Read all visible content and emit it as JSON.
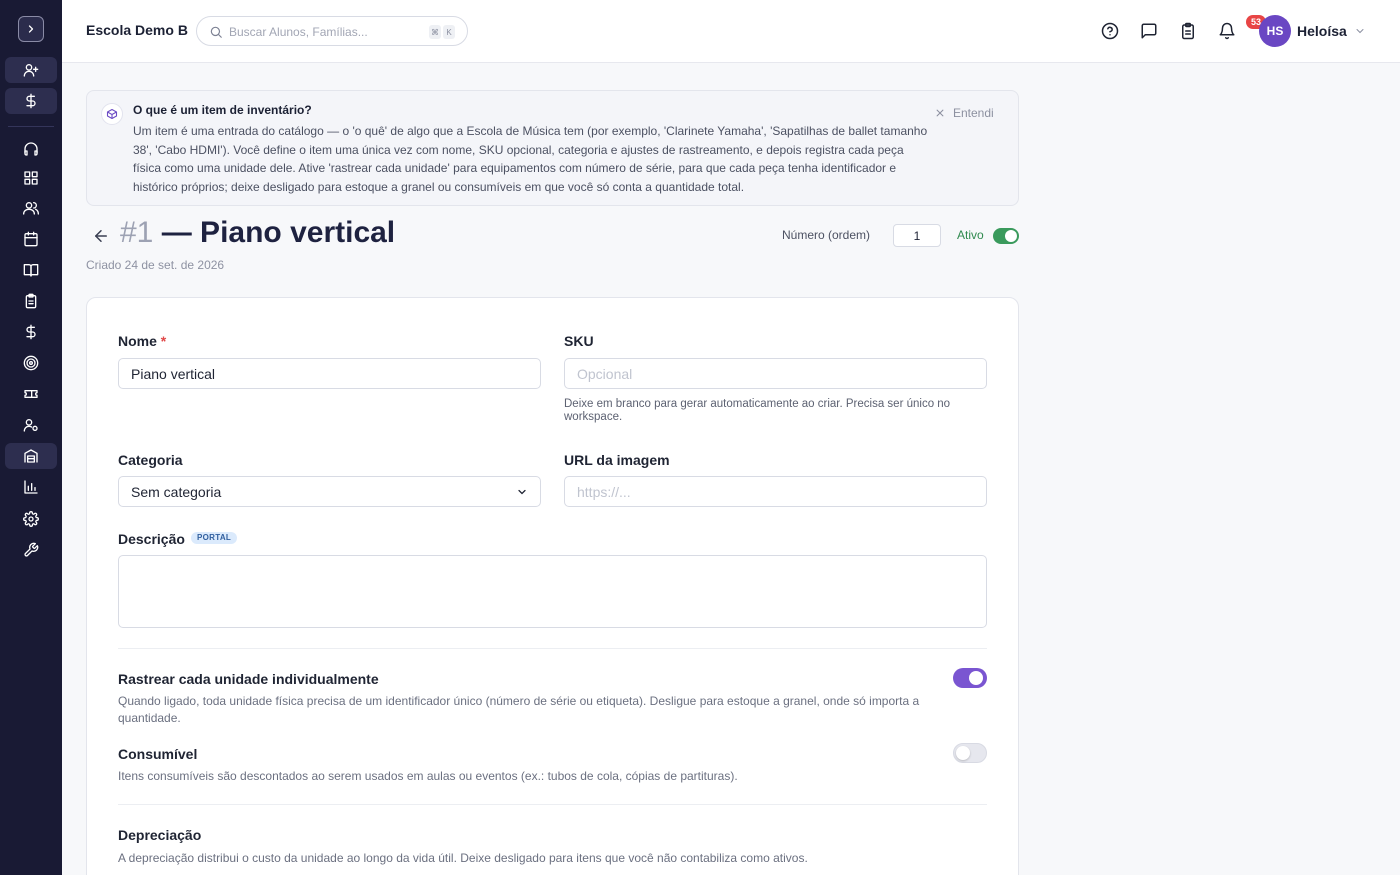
{
  "header": {
    "school_name": "Escola Demo B",
    "search_placeholder": "Buscar Alunos, Famílias...",
    "shortcut_keys": [
      "⌘",
      "K"
    ],
    "tasks_badge": "53",
    "user_initials": "HS",
    "user_name": "Heloísa"
  },
  "sidebar": {
    "items": [
      {
        "name": "add-user-icon"
      },
      {
        "name": "dollar-icon"
      },
      {
        "name": "headset-icon"
      },
      {
        "name": "dashboard-icon"
      },
      {
        "name": "users-icon"
      },
      {
        "name": "calendar-icon"
      },
      {
        "name": "book-icon"
      },
      {
        "name": "clipboard-icon"
      },
      {
        "name": "dollar-icon"
      },
      {
        "name": "target-icon"
      },
      {
        "name": "ticket-icon"
      },
      {
        "name": "user-settings-icon"
      },
      {
        "name": "inventory-icon"
      },
      {
        "name": "chart-icon"
      },
      {
        "name": "settings-icon"
      },
      {
        "name": "wrench-icon"
      }
    ]
  },
  "banner": {
    "title": "O que é um item de inventário?",
    "text": "Um item é uma entrada do catálogo — o 'o quê' de algo que a Escola de Música tem (por exemplo, 'Clarinete Yamaha', 'Sapatilhas de ballet tamanho 38', 'Cabo HDMI'). Você define o item uma única vez com nome, SKU opcional, categoria e ajustes de rastreamento, e depois registra cada peça física como uma unidade dele. Ative 'rastrear cada unidade' para equipamentos com número de série, para que cada peça tenha identificador e histórico próprios; deixe desligado para estoque a granel ou consumíveis em que você só conta a quantidade total.",
    "dismiss": "Entendi"
  },
  "title": {
    "number": "#1",
    "name": "— Piano vertical",
    "created": "Criado 24 de set. de 2026",
    "order_label": "Número (ordem)",
    "order_value": "1",
    "active_label": "Ativo",
    "active_on": true
  },
  "form": {
    "name_label": "Nome",
    "required_mark": "*",
    "name_value": "Piano vertical",
    "sku_label": "SKU",
    "sku_placeholder": "Opcional",
    "sku_help": "Deixe em branco para gerar automaticamente ao criar. Precisa ser único no workspace.",
    "category_label": "Categoria",
    "category_value": "Sem categoria",
    "image_label": "URL da imagem",
    "image_placeholder": "https://...",
    "description_label": "Descrição",
    "description_badge": "PORTAL",
    "description_value": ""
  },
  "settings": {
    "track_title": "Rastrear cada unidade individualmente",
    "track_desc": "Quando ligado, toda unidade física precisa de um identificador único (número de série ou etiqueta). Desligue para estoque a granel, onde só importa a quantidade.",
    "track_on": true,
    "consumable_title": "Consumível",
    "consumable_desc": "Itens consumíveis são descontados ao serem usados em aulas ou eventos (ex.: tubos de cola, cópias de partituras).",
    "consumable_on": false,
    "depreciation_title": "Depreciação",
    "depreciation_desc": "A depreciação distribui o custo da unidade ao longo da vida útil. Deixe desligado para itens que você não contabiliza como ativos."
  },
  "colors": {
    "sidebar_bg": "#191a34",
    "accent_purple": "#7a55d1",
    "active_green": "#3a9a5c",
    "badge_red": "#e84545"
  }
}
